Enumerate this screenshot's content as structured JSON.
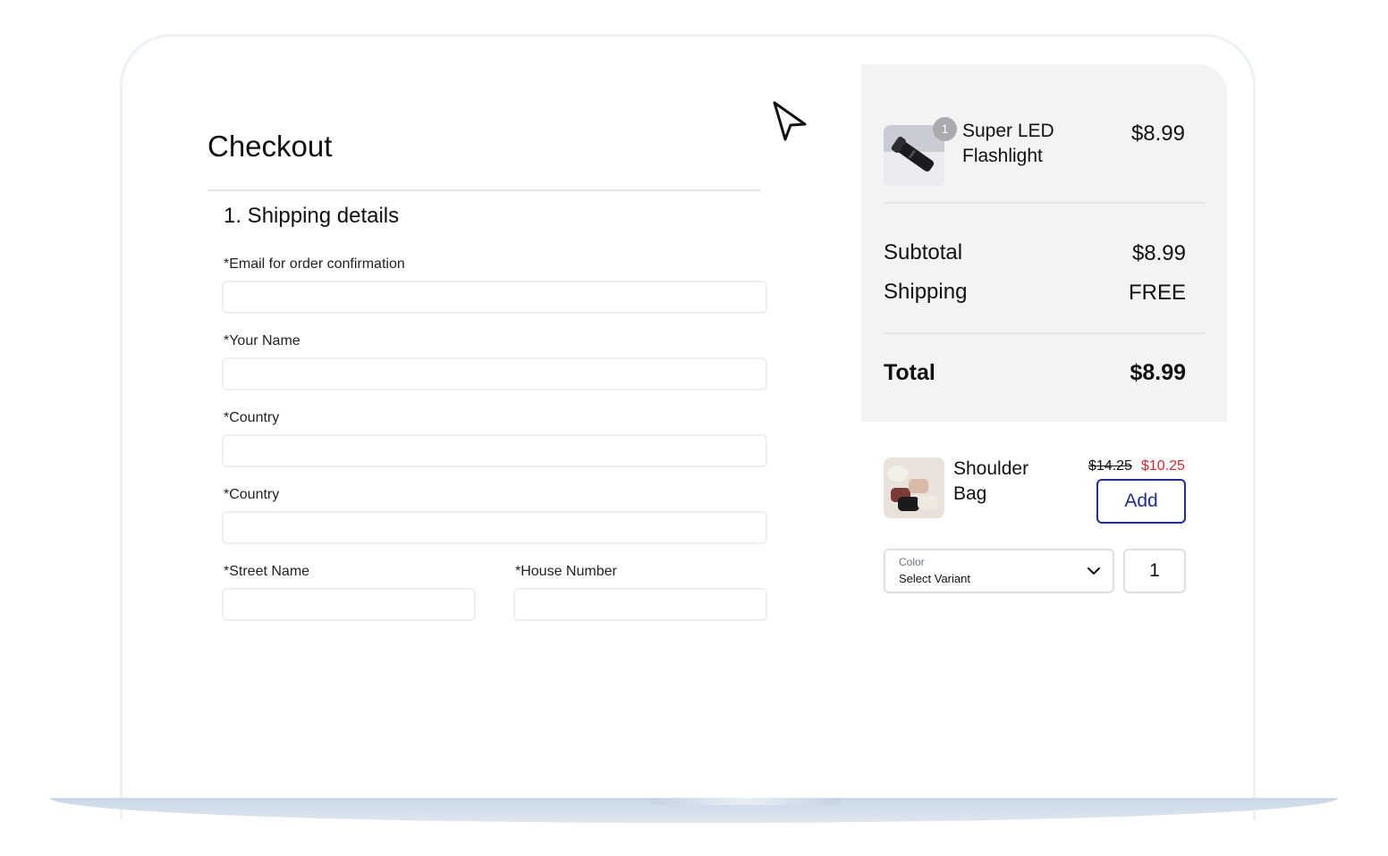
{
  "checkout": {
    "title": "Checkout",
    "section_title": "1. Shipping details",
    "fields": {
      "email_label": "*Email for order confirmation",
      "name_label": "*Your Name",
      "country_label_1": "*Country",
      "country_label_2": "*Country",
      "street_label": "*Street Name",
      "house_label": "*House Number"
    }
  },
  "cart": {
    "item": {
      "name_line1": "Super LED",
      "name_line2": "Flashlight",
      "price": "$8.99",
      "quantity": "1"
    },
    "subtotal_label": "Subtotal",
    "subtotal_value": "$8.99",
    "shipping_label": "Shipping",
    "shipping_value": "FREE",
    "total_label": "Total",
    "total_value": "$8.99"
  },
  "upsell": {
    "name_line1": "Shoulder",
    "name_line2": "Bag",
    "old_price": "$14.25",
    "new_price": "$10.25",
    "add_label": "Add",
    "variant_label": "Color",
    "variant_value": "Select Variant",
    "quantity": "1"
  },
  "colors": {
    "accent": "#1f2f8f",
    "sale": "#e0262b",
    "summary_bg": "#f3f3f4"
  },
  "icons": [
    "cursor-pointer-icon",
    "chevron-down-icon"
  ]
}
